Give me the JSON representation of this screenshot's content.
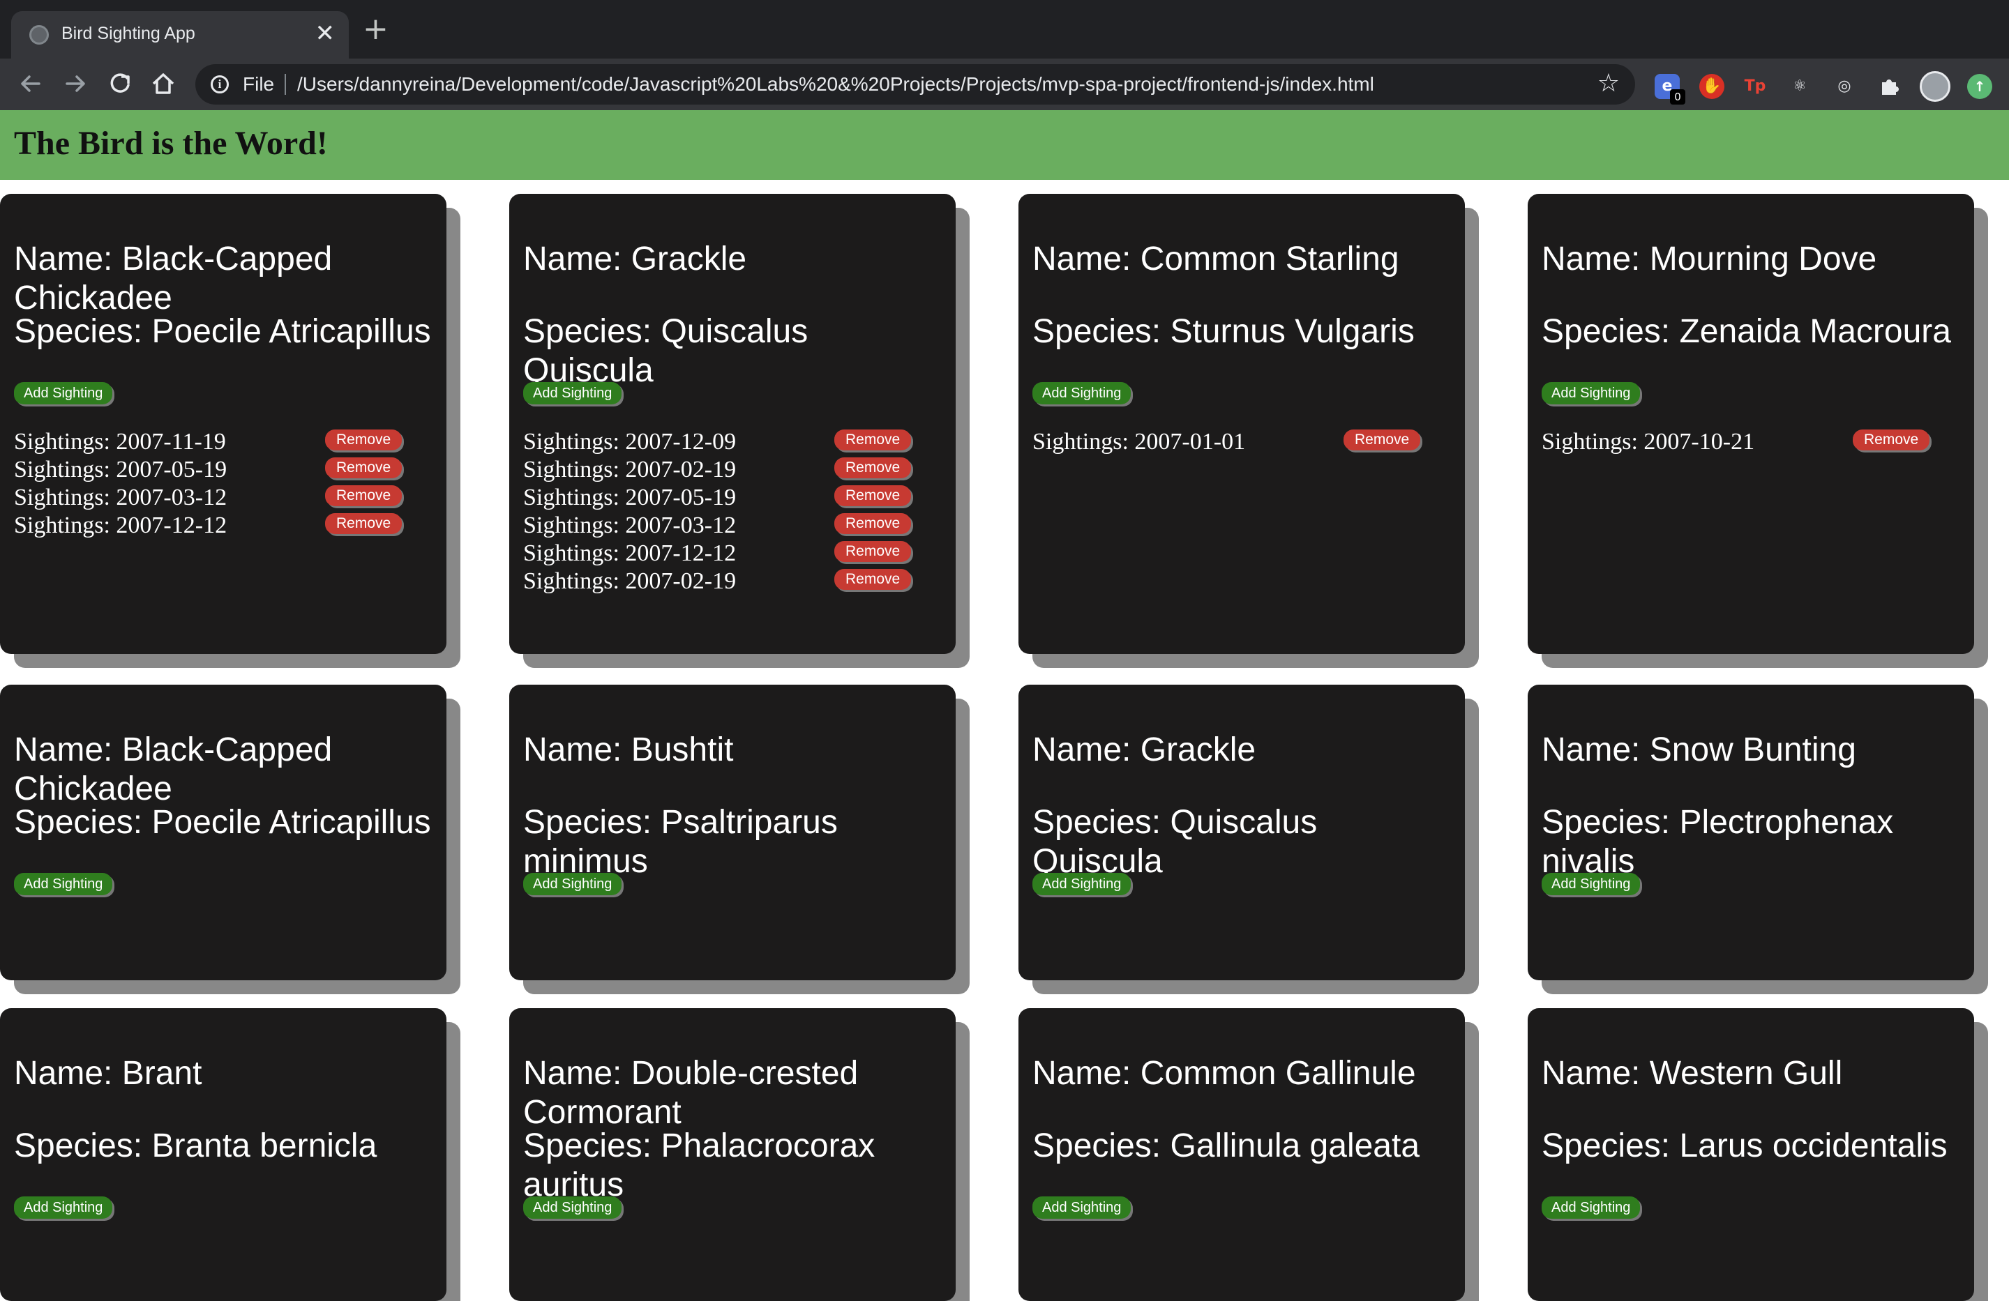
{
  "browser": {
    "tab_title": "Bird Sighting App",
    "tab_close": "✕",
    "new_tab": "+",
    "omnibox_label": "File",
    "url": "/Users/dannyreina/Development/code/Javascript%20Labs%20&%20Projects/Projects/mvp-spa-project/frontend-js/index.html",
    "info_icon": "i",
    "extension_badge_count": "0",
    "icons": [
      "back-icon",
      "forward-icon",
      "reload-icon",
      "home-icon",
      "info-icon",
      "star-icon",
      "extension-icons",
      "profile-avatar"
    ]
  },
  "app": {
    "title": "The Bird is the Word!",
    "add_label": "Add Sighting",
    "remove_label": "Remove",
    "colors": {
      "header": "#6aae5f",
      "card": "#1c1b1b",
      "card_shadow": "#888888",
      "add_button": "#2f7d1e",
      "remove_button": "#c73a32"
    }
  },
  "birds": [
    {
      "name": "Name: Black-Capped Chickadee",
      "species": "Species: Poecile Atricapillus",
      "sightings": [
        "Sightings: 2007-11-19",
        "Sightings: 2007-05-19",
        "Sightings: 2007-03-12",
        "Sightings: 2007-12-12"
      ]
    },
    {
      "name": "Name: Grackle",
      "species": "Species: Quiscalus Quiscula",
      "sightings": [
        "Sightings: 2007-12-09",
        "Sightings: 2007-02-19",
        "Sightings: 2007-05-19",
        "Sightings: 2007-03-12",
        "Sightings: 2007-12-12",
        "Sightings: 2007-02-19"
      ]
    },
    {
      "name": "Name: Common Starling",
      "species": "Species: Sturnus Vulgaris",
      "sightings": [
        "Sightings: 2007-01-01"
      ]
    },
    {
      "name": "Name: Mourning Dove",
      "species": "Species: Zenaida Macroura",
      "sightings": [
        "Sightings: 2007-10-21"
      ]
    },
    {
      "name": "Name: Black-Capped Chickadee",
      "species": "Species: Poecile Atricapillus",
      "sightings": []
    },
    {
      "name": "Name: Bushtit",
      "species": "Species: Psaltriparus minimus",
      "sightings": []
    },
    {
      "name": "Name: Grackle",
      "species": "Species: Quiscalus Quiscula",
      "sightings": []
    },
    {
      "name": "Name: Snow Bunting",
      "species": "Species: Plectrophenax nivalis",
      "sightings": []
    },
    {
      "name": "Name: Brant",
      "species": "Species: Branta bernicla",
      "sightings": []
    },
    {
      "name": "Name: Double-crested Cormorant",
      "species": "Species: Phalacrocorax auritus",
      "sightings": []
    },
    {
      "name": "Name: Common Gallinule",
      "species": "Species: Gallinula galeata",
      "sightings": []
    },
    {
      "name": "Name: Western Gull",
      "species": "Species: Larus occidentalis",
      "sightings": []
    }
  ]
}
